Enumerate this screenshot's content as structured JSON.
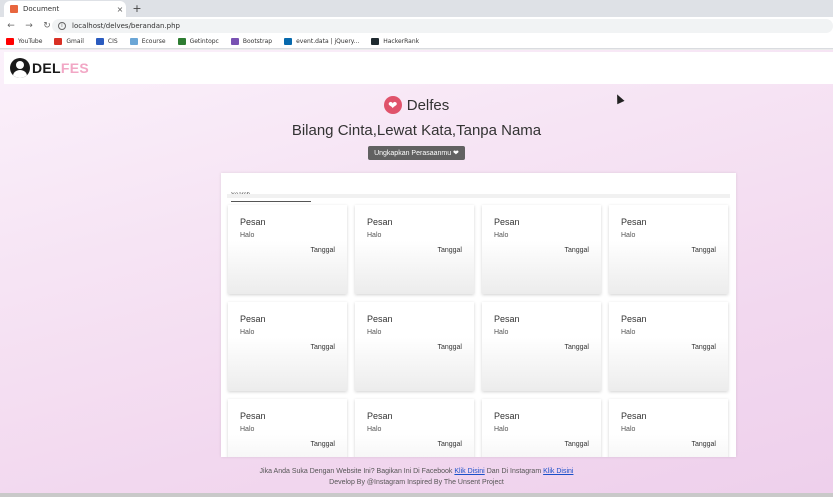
{
  "browser": {
    "tab_title": "Document",
    "tab_close": "×",
    "new_tab": "+",
    "url": "localhost/delves/berandan.php",
    "bookmarks": [
      {
        "label": "YouTube",
        "icon": "youtube-icon",
        "color": "#ff0000"
      },
      {
        "label": "Gmail",
        "icon": "gmail-icon",
        "color": "#d93025"
      },
      {
        "label": "CIS",
        "icon": "cis-icon",
        "color": "#2a5bbf"
      },
      {
        "label": "Ecourse",
        "icon": "ecourse-icon",
        "color": "#6ba6d6"
      },
      {
        "label": "Getintopc",
        "icon": "getintopc-icon",
        "color": "#2e7d32"
      },
      {
        "label": "Bootstrap",
        "icon": "bootstrap-icon",
        "color": "#7952b3"
      },
      {
        "label": "event.data | jQuery...",
        "icon": "jquery-icon",
        "color": "#0769ad"
      },
      {
        "label": "HackerRank",
        "icon": "hackerrank-icon",
        "color": "#1f2a30"
      }
    ]
  },
  "navbar": {
    "brand_part1": "DEL",
    "brand_part2": "FES",
    "brand_color": "#f2a7c5"
  },
  "hero": {
    "logo_name": "Delfes",
    "heart_color": "#e0536b",
    "tagline": "Bilang Cinta,Lewat Kata,Tanpa Nama",
    "cta_label": "Ungkapkan Perasaanmu ❤"
  },
  "search": {
    "placeholder": "Search"
  },
  "cards": [
    {
      "title": "Pesan",
      "message": "Halo",
      "date": "Tanggal"
    },
    {
      "title": "Pesan",
      "message": "Halo",
      "date": "Tanggal"
    },
    {
      "title": "Pesan",
      "message": "Halo",
      "date": "Tanggal"
    },
    {
      "title": "Pesan",
      "message": "Halo",
      "date": "Tanggal"
    },
    {
      "title": "Pesan",
      "message": "Halo",
      "date": "Tanggal"
    },
    {
      "title": "Pesan",
      "message": "Halo",
      "date": "Tanggal"
    },
    {
      "title": "Pesan",
      "message": "Halo",
      "date": "Tanggal"
    },
    {
      "title": "Pesan",
      "message": "Halo",
      "date": "Tanggal"
    },
    {
      "title": "Pesan",
      "message": "Halo",
      "date": "Tanggal"
    },
    {
      "title": "Pesan",
      "message": "Halo",
      "date": "Tanggal"
    },
    {
      "title": "Pesan",
      "message": "Halo",
      "date": "Tanggal"
    },
    {
      "title": "Pesan",
      "message": "Halo",
      "date": "Tanggal"
    }
  ],
  "footer": {
    "line1_prefix": "Jika Anda Suka Dengan Website Ini? Bagikan Ini Di Facebook",
    "facebook_link": "Klik Disini",
    "line1_middle": "Dan Di Instagram",
    "instagram_link": "Klik Disini",
    "line2": "Develop By @Instagram Inspired By The Unsent Project"
  }
}
